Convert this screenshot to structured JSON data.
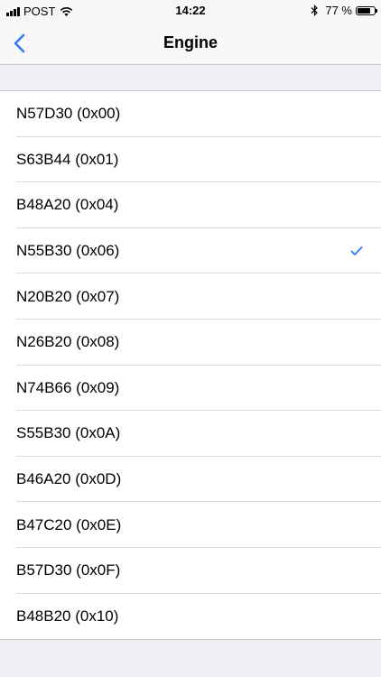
{
  "status_bar": {
    "carrier": "POST",
    "time": "14:22",
    "battery_text": "77 %",
    "battery_level": 0.77,
    "signal_bars": 4
  },
  "nav": {
    "title": "Engine",
    "back_icon": "chevron-left-icon"
  },
  "accent_color": "#3478f6",
  "engines": [
    {
      "label": "N57D30 (0x00)",
      "selected": false
    },
    {
      "label": "S63B44 (0x01)",
      "selected": false
    },
    {
      "label": "B48A20 (0x04)",
      "selected": false
    },
    {
      "label": "N55B30 (0x06)",
      "selected": true
    },
    {
      "label": "N20B20 (0x07)",
      "selected": false
    },
    {
      "label": "N26B20 (0x08)",
      "selected": false
    },
    {
      "label": "N74B66 (0x09)",
      "selected": false
    },
    {
      "label": "S55B30 (0x0A)",
      "selected": false
    },
    {
      "label": "B46A20 (0x0D)",
      "selected": false
    },
    {
      "label": "B47C20 (0x0E)",
      "selected": false
    },
    {
      "label": "B57D30 (0x0F)",
      "selected": false
    },
    {
      "label": "B48B20 (0x10)",
      "selected": false
    }
  ]
}
